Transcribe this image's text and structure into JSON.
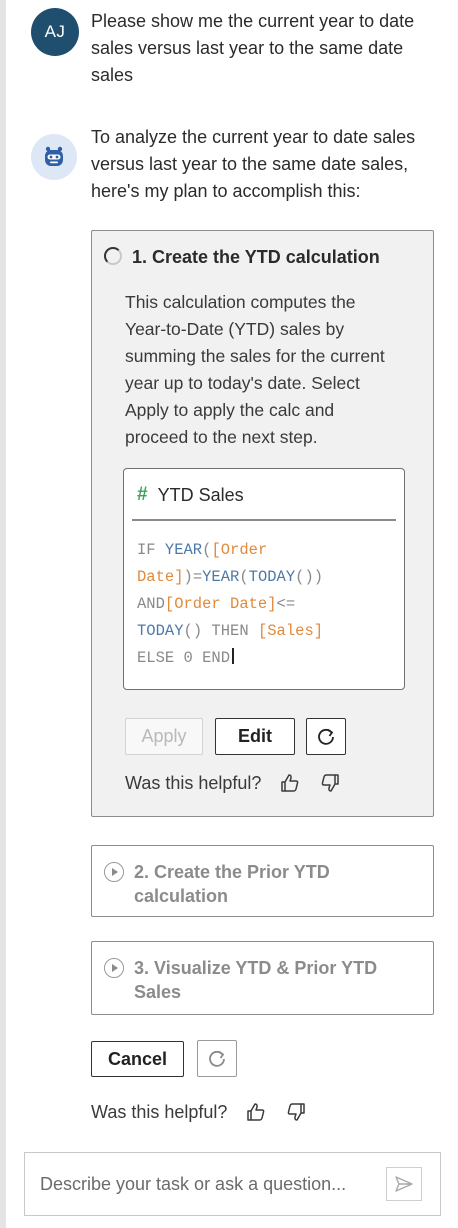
{
  "user": {
    "initials": "AJ",
    "message": "Please show me the current year to date sales versus last year to the same date sales"
  },
  "assistant": {
    "message": "To analyze the current year to date sales versus last year to the same date sales, here's my plan to accomplish this:"
  },
  "steps": [
    {
      "title": "1. Create the YTD calculation",
      "status": "in-progress",
      "description": "This calculation computes the Year-to-Date (YTD) sales by summing the sales for the current year up to today's date. Select Apply to apply the calc and proceed to the next step.",
      "calc": {
        "name": "YTD Sales",
        "code_lines": [
          [
            {
              "t": "IF ",
              "c": "kw"
            },
            {
              "t": "YEAR",
              "c": "fn"
            },
            {
              "t": "(",
              "c": "kw"
            },
            {
              "t": "[Order",
              "c": "fld"
            }
          ],
          [
            {
              "t": "Date]",
              "c": "fld"
            },
            {
              "t": ")=",
              "c": "kw"
            },
            {
              "t": "YEAR",
              "c": "fn"
            },
            {
              "t": "(",
              "c": "kw"
            },
            {
              "t": "TODAY",
              "c": "fn"
            },
            {
              "t": "())",
              "c": "kw"
            }
          ],
          [
            {
              "t": "AND",
              "c": "kw"
            },
            {
              "t": "[Order Date]",
              "c": "fld"
            },
            {
              "t": "<=",
              "c": "kw"
            }
          ],
          [
            {
              "t": "TODAY",
              "c": "fn"
            },
            {
              "t": "() THEN ",
              "c": "kw"
            },
            {
              "t": "[Sales]",
              "c": "fld"
            }
          ],
          [
            {
              "t": "ELSE 0 END",
              "c": "kw"
            }
          ]
        ]
      },
      "apply_label": "Apply",
      "edit_label": "Edit",
      "helpful_label": "Was this helpful?"
    },
    {
      "title": "2. Create the Prior YTD calculation",
      "status": "pending"
    },
    {
      "title": "3. Visualize YTD & Prior YTD Sales",
      "status": "pending"
    }
  ],
  "actions": {
    "cancel_label": "Cancel",
    "helpful_label": "Was this helpful?"
  },
  "composer": {
    "placeholder": "Describe your task or ask a question..."
  },
  "colors": {
    "user_avatar": "#1f4e6e",
    "bot_avatar_bg": "#dde7f6",
    "function": "#4e79a7",
    "field": "#e08a3c"
  }
}
